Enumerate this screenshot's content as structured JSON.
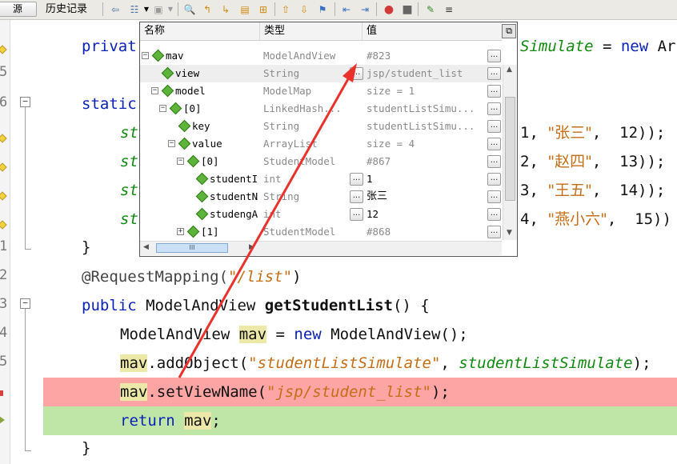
{
  "toolbar": {
    "source_button": "源",
    "history_label": "历史记录"
  },
  "gutter": {
    "line_numbers": [
      "5",
      "6",
      "1",
      "2",
      "3",
      "4",
      "5"
    ]
  },
  "code": {
    "line_private": {
      "kw": "privat",
      "field": "Simulate",
      "rest1": " = ",
      "kw2": "new",
      "rest2": " Ar"
    },
    "line_static": {
      "kw": "static"
    },
    "adds": [
      {
        "prefix": "st",
        "num": "1,",
        "name": "\"张三\"",
        "tail": ",  12));"
      },
      {
        "prefix": "st",
        "num": "2,",
        "name": "\"赵四\"",
        "tail": ",  13));"
      },
      {
        "prefix": "st",
        "num": "3,",
        "name": "\"王五\"",
        "tail": ",  14));"
      },
      {
        "prefix": "st",
        "num": "4,",
        "name": "\"燕小六\"",
        "tail": ",  15))"
      }
    ],
    "line_close": "}",
    "line_annotation": {
      "name": "@RequestMapping(",
      "str": "\"/list\"",
      "end": ")"
    },
    "line_method": {
      "kw": "public",
      "type": " ModelAndView ",
      "name": "getStudentList",
      "end": "() {"
    },
    "line_new": {
      "type": "ModelAndView ",
      "var": "mav",
      "mid": " = ",
      "kw": "new",
      "end": " ModelAndView();"
    },
    "line_add": {
      "var": "mav",
      "call": ".addObject(",
      "str": "\"studentListSimulate\"",
      "comma": ", ",
      "field": "studentListSimulate",
      "end": ");"
    },
    "line_setview": {
      "var": "mav",
      "call": ".setViewName(",
      "str": "\"jsp/student_list\"",
      "end": ");"
    },
    "line_return": {
      "kw": "return",
      "sp": " ",
      "var": "mav",
      "end": ";"
    },
    "line_final": "}"
  },
  "popup": {
    "headers": {
      "name": "名称",
      "type": "类型",
      "value": "值"
    },
    "rows": [
      {
        "name": "mav",
        "type": "ModelAndView",
        "value": "#823"
      },
      {
        "name": "view",
        "type": "String",
        "value": "jsp/student_list"
      },
      {
        "name": "model",
        "type": "ModelMap",
        "value": "size = 1"
      },
      {
        "name": "[0]",
        "type": "LinkedHash...",
        "value": "studentListSimu..."
      },
      {
        "name": "key",
        "type": "String",
        "value": "studentListSimu..."
      },
      {
        "name": "value",
        "type": "ArrayList",
        "value": "size = 4"
      },
      {
        "name": "[0]",
        "type": "StudentModel",
        "value": "#867"
      },
      {
        "name": "studentI",
        "type": "int",
        "value": "1"
      },
      {
        "name": "studentN",
        "type": "String",
        "value": "张三"
      },
      {
        "name": "studengA",
        "type": "int",
        "value": "12"
      },
      {
        "name": "[1]",
        "type": "StudentModel",
        "value": "#868"
      }
    ],
    "dots_label": "...",
    "scroll_thumb_label": "III"
  },
  "colors": {
    "breakpoint_line": "#fda4a4",
    "current_line": "#bfe6a7",
    "keyword": "#0a22b8",
    "string": "#c46e18",
    "field": "#108a10",
    "arrow": "#e8322b"
  }
}
